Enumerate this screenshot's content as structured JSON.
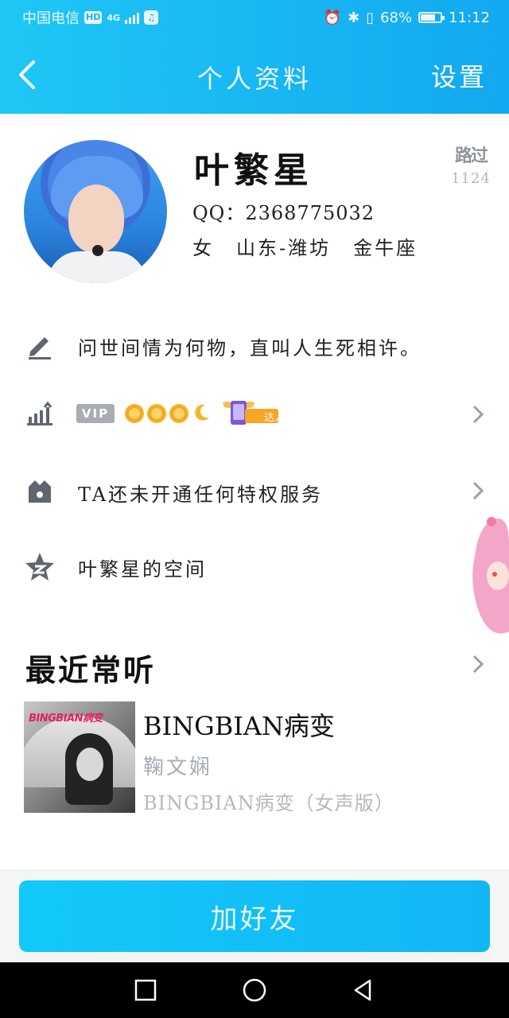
{
  "status_bar": {
    "carrier": "中国电信",
    "hd_badge": "HD",
    "network": "4G",
    "battery_percent": "68%",
    "time": "11:12"
  },
  "nav": {
    "title": "个人资料",
    "settings_label": "设置"
  },
  "profile": {
    "name": "叶繁星",
    "qq_label": "QQ：",
    "qq_number": "2368775032",
    "gender": "女",
    "location": "山东-潍坊",
    "zodiac": "金牛座",
    "visits_label": "路过",
    "visits_count": "1124"
  },
  "rows": {
    "signature": "问世间情为何物，直叫人生死相许。",
    "vip_badge": "VIP",
    "talent_badge": "达人",
    "privilege": "TA还未开通任何特权服务",
    "space": "叶繁星的空间"
  },
  "recent": {
    "title": "最近常听",
    "song_title": "BINGBIAN病变",
    "artist": "鞠文娴",
    "album": "BINGBIAN病变（女声版）",
    "cover_text": "BINGBIAN病变"
  },
  "actions": {
    "add_friend": "加好友"
  },
  "colors": {
    "header_gradient_start": "#1ec7f5",
    "header_gradient_end": "#13a8f0",
    "button": "#12c0f7"
  }
}
